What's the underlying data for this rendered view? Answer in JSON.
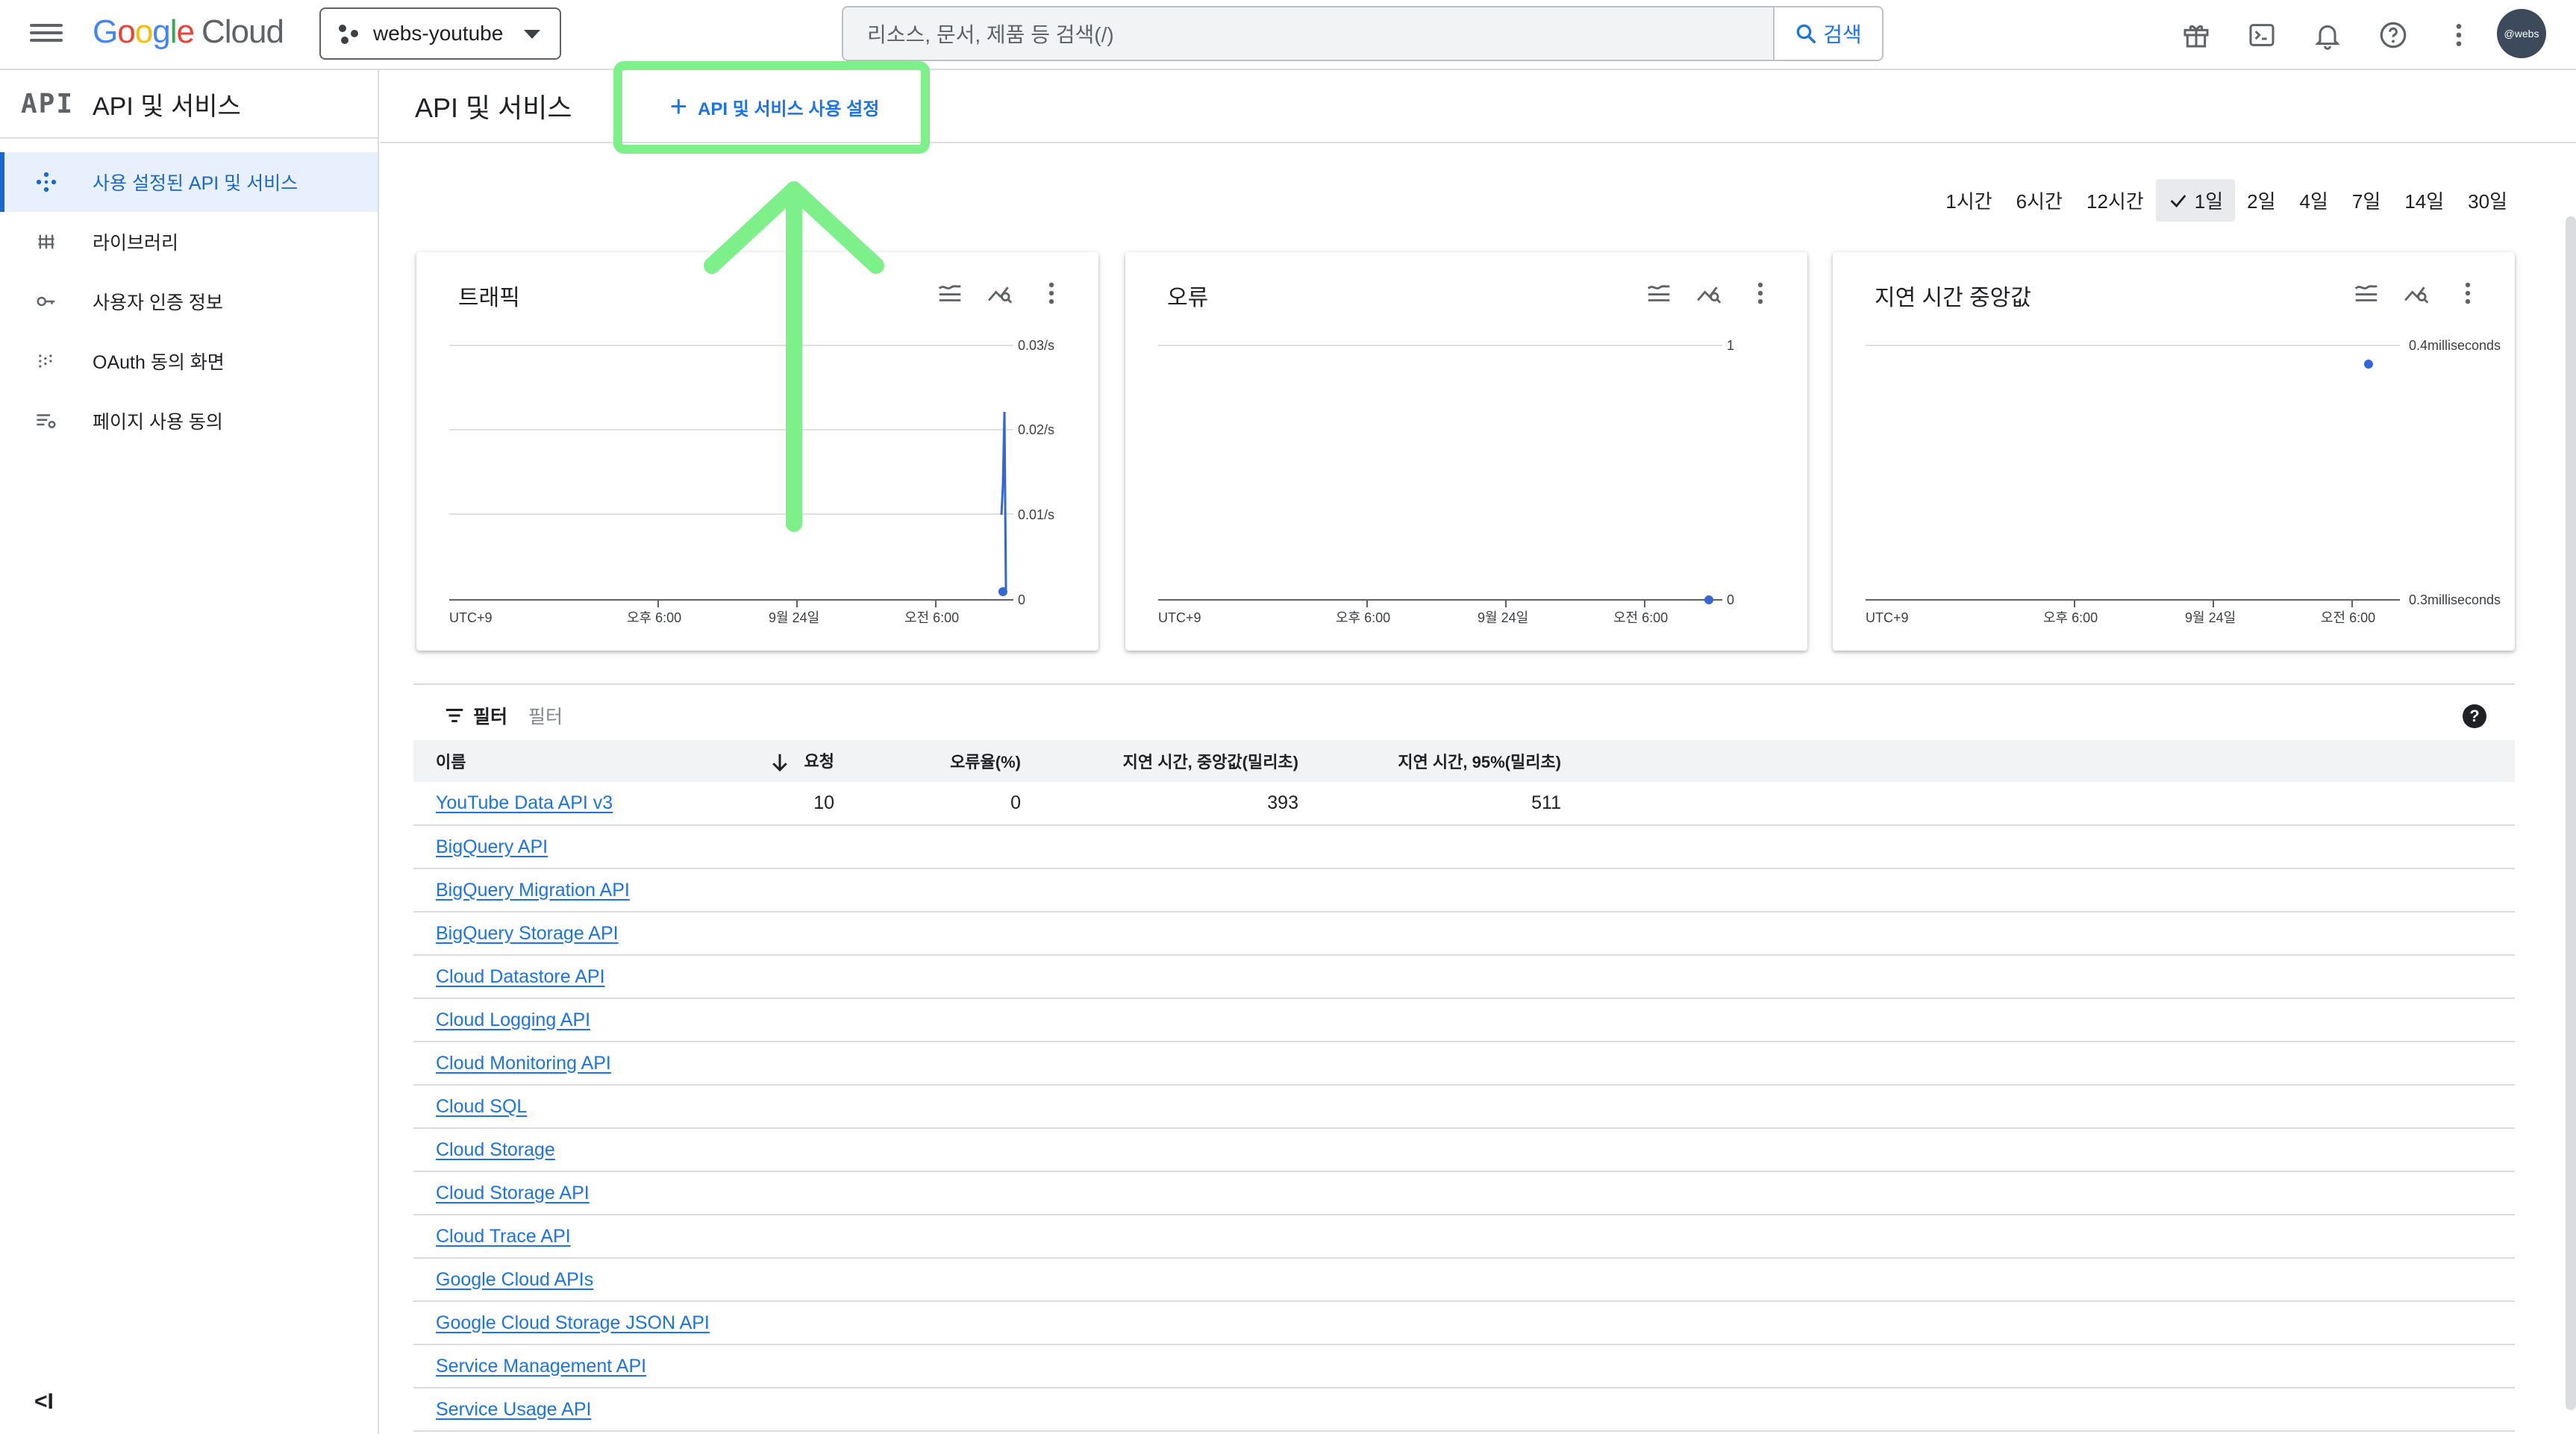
{
  "topbar": {
    "logo_google": "Google",
    "logo_cloud": "Cloud",
    "project": "webs-youtube",
    "search_placeholder": "리소스, 문서, 제품 등 검색(/)",
    "search_button": "검색",
    "avatar_label": "@webs",
    "icons": [
      "gift-icon",
      "terminal-icon",
      "bell-icon",
      "help-icon",
      "more-vert-icon"
    ]
  },
  "sidebar": {
    "logo": "API",
    "title": "API 및 서비스",
    "items": [
      {
        "label": "사용 설정된 API 및 서비스",
        "icon": "diamond-dots-icon",
        "active": true
      },
      {
        "label": "라이브러리",
        "icon": "library-icon",
        "active": false
      },
      {
        "label": "사용자 인증 정보",
        "icon": "key-icon",
        "active": false
      },
      {
        "label": "OAuth 동의 화면",
        "icon": "consent-icon",
        "active": false
      },
      {
        "label": "페이지 사용 동의",
        "icon": "settings-list-icon",
        "active": false
      }
    ],
    "collapse_label": "<I"
  },
  "main": {
    "title": "API 및 서비스",
    "enable_button": "API 및 서비스 사용 설정",
    "time_ranges": [
      "1시간",
      "6시간",
      "12시간",
      "1일",
      "2일",
      "4일",
      "7일",
      "14일",
      "30일"
    ],
    "selected_range": "1일",
    "filter_label": "필터",
    "filter_placeholder": "필터"
  },
  "charts": [
    {
      "title": "트래픽",
      "y_ticks": [
        "0.03/s",
        "0.02/s",
        "0.01/s",
        "0"
      ],
      "x_ticks": [
        "UTC+9",
        "오후 6:00",
        "9월 24일",
        "오전 6:00"
      ]
    },
    {
      "title": "오류",
      "y_ticks": [
        "1",
        "0"
      ],
      "x_ticks": [
        "UTC+9",
        "오후 6:00",
        "9월 24일",
        "오전 6:00"
      ]
    },
    {
      "title": "지연 시간 중앙값",
      "y_ticks": [
        "0.4milliseconds",
        "0.3milliseconds"
      ],
      "x_ticks": [
        "UTC+9",
        "오후 6:00",
        "9월 24일",
        "오전 6:00"
      ]
    }
  ],
  "table": {
    "headers": [
      "이름",
      "요청",
      "오류율(%)",
      "지연 시간, 중앙값(밀리초)",
      "지연 시간, 95%(밀리초)"
    ],
    "rows": [
      [
        "YouTube Data API v3",
        "10",
        "0",
        "393",
        "511"
      ],
      [
        "BigQuery API",
        "",
        "",
        "",
        ""
      ],
      [
        "BigQuery Migration API",
        "",
        "",
        "",
        ""
      ],
      [
        "BigQuery Storage API",
        "",
        "",
        "",
        ""
      ],
      [
        "Cloud Datastore API",
        "",
        "",
        "",
        ""
      ],
      [
        "Cloud Logging API",
        "",
        "",
        "",
        ""
      ],
      [
        "Cloud Monitoring API",
        "",
        "",
        "",
        ""
      ],
      [
        "Cloud SQL",
        "",
        "",
        "",
        ""
      ],
      [
        "Cloud Storage",
        "",
        "",
        "",
        ""
      ],
      [
        "Cloud Storage API",
        "",
        "",
        "",
        ""
      ],
      [
        "Cloud Trace API",
        "",
        "",
        "",
        ""
      ],
      [
        "Google Cloud APIs",
        "",
        "",
        "",
        ""
      ],
      [
        "Google Cloud Storage JSON API",
        "",
        "",
        "",
        ""
      ],
      [
        "Service Management API",
        "",
        "",
        "",
        ""
      ],
      [
        "Service Usage API",
        "",
        "",
        "",
        ""
      ]
    ]
  },
  "colors": {
    "accent": "#1a73e8",
    "highlight": "#7ef08a",
    "active_bg": "#e8f0fe"
  }
}
